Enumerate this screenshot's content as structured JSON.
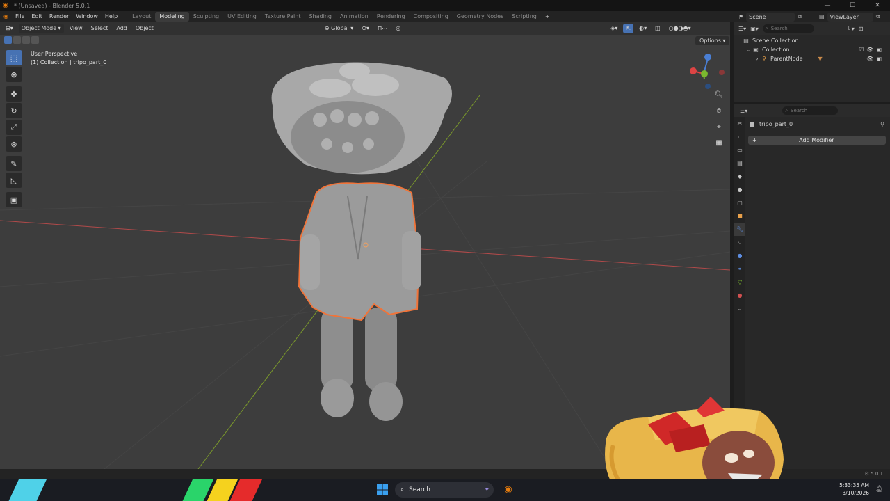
{
  "window": {
    "title": "* (Unsaved) - Blender 5.0.1",
    "minimize": "—",
    "maximize": "☐",
    "close": "✕"
  },
  "menu": {
    "items": [
      "File",
      "Edit",
      "Render",
      "Window",
      "Help"
    ],
    "workspaces": [
      "Layout",
      "Modeling",
      "Sculpting",
      "UV Editing",
      "Texture Paint",
      "Shading",
      "Animation",
      "Rendering",
      "Compositing",
      "Geometry Nodes",
      "Scripting"
    ],
    "active_workspace": "Modeling",
    "add_workspace": "+",
    "scene": "Scene",
    "view_layer": "ViewLayer"
  },
  "viewport": {
    "mode": "Object Mode",
    "menus": [
      "View",
      "Select",
      "Add",
      "Object"
    ],
    "transform_orientation": "Global",
    "options": "Options",
    "overlay_line1": "User Perspective",
    "overlay_line2": "(1) Collection | tripo_part_0",
    "gizmo_axes": [
      "X",
      "Y",
      "Z"
    ],
    "accent_color": "#4772b3",
    "selection_outline_color": "#f0743a"
  },
  "toolbar": {
    "tools": [
      "select-box-icon",
      "cursor-icon",
      "move-icon",
      "rotate-icon",
      "scale-icon",
      "transform-icon",
      "annotate-icon",
      "measure-icon",
      "add-cube-icon"
    ],
    "active_index": 0
  },
  "outliner": {
    "search_placeholder": "Search",
    "root": "Scene Collection",
    "collection": "Collection",
    "child": "ParentNode"
  },
  "properties": {
    "search_placeholder": "Search",
    "object_name": "tripo_part_0",
    "add_modifier": "Add Modifier",
    "active_tab": "wrench-modifier-icon"
  },
  "statusbar": {
    "version": "5.0.1"
  },
  "taskbar": {
    "search_label": "Search",
    "time": "5:33:35 AM",
    "date": "3/10/2026"
  }
}
